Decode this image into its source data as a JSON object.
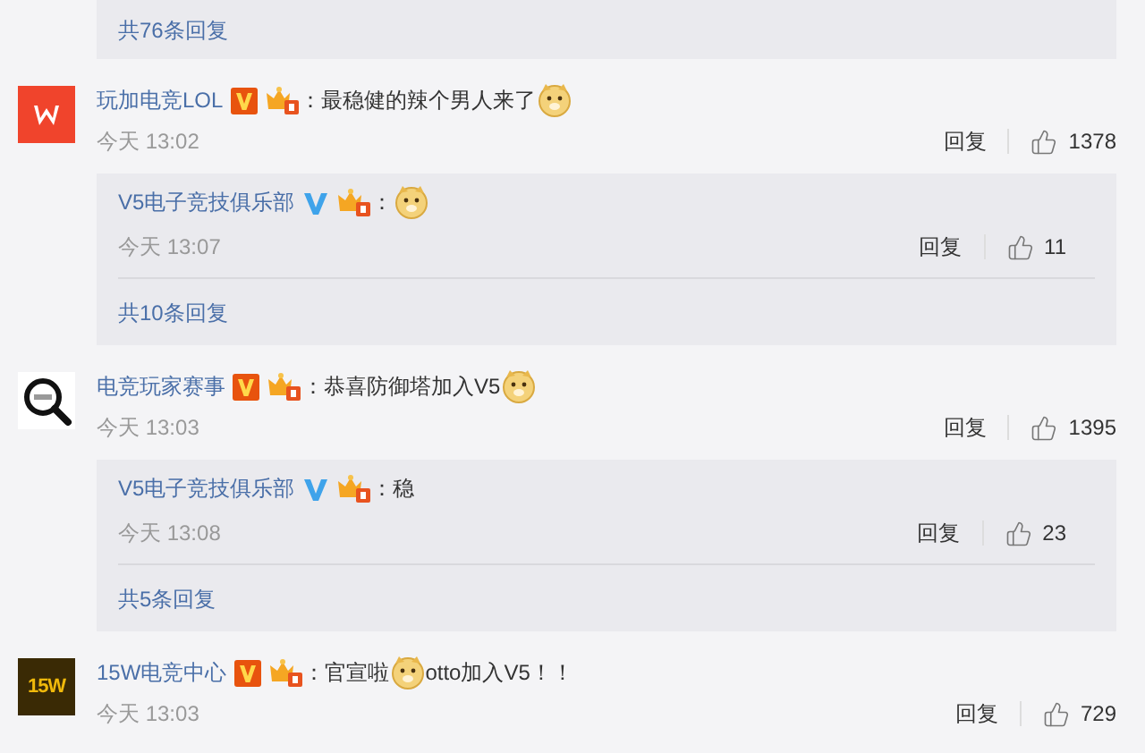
{
  "top_more": "共76条回复",
  "comments": [
    {
      "avatar": {
        "kind": "red"
      },
      "author": "玩加电竞LOL",
      "color": "#e8530e",
      "segments": [
        {
          "kind": "text",
          "text": "：最稳健的辣个男人来了"
        },
        {
          "kind": "emoji"
        }
      ],
      "time": "今天 13:02",
      "reply_label": "回复",
      "likes": "1378",
      "replies": [
        {
          "author": "V5电子竞技俱乐部",
          "color": "#3fa3ea",
          "segments": [
            {
              "kind": "text",
              "text": "："
            },
            {
              "kind": "emoji"
            }
          ],
          "time": "今天 13:07",
          "reply_label": "回复",
          "likes": "11"
        }
      ],
      "more": "共10条回复"
    },
    {
      "avatar": {
        "kind": "magnifier"
      },
      "author": "电竞玩家赛事",
      "color": "#e8530e",
      "segments": [
        {
          "kind": "text",
          "text": "：恭喜防御塔加入V5"
        },
        {
          "kind": "emoji"
        }
      ],
      "time": "今天 13:03",
      "reply_label": "回复",
      "likes": "1395",
      "replies": [
        {
          "author": "V5电子竞技俱乐部",
          "color": "#3fa3ea",
          "segments": [
            {
              "kind": "text",
              "text": "：稳"
            }
          ],
          "time": "今天 13:08",
          "reply_label": "回复",
          "likes": "23"
        }
      ],
      "more": "共5条回复"
    },
    {
      "avatar": {
        "kind": "logo",
        "text": "15W"
      },
      "author": "15W电竞中心",
      "color": "#e8530e",
      "segments": [
        {
          "kind": "text",
          "text": "：官宣啦"
        },
        {
          "kind": "emoji"
        },
        {
          "kind": "text",
          "text": "otto加入V5！！"
        }
      ],
      "time": "今天 13:03",
      "reply_label": "回复",
      "likes": "729"
    }
  ]
}
